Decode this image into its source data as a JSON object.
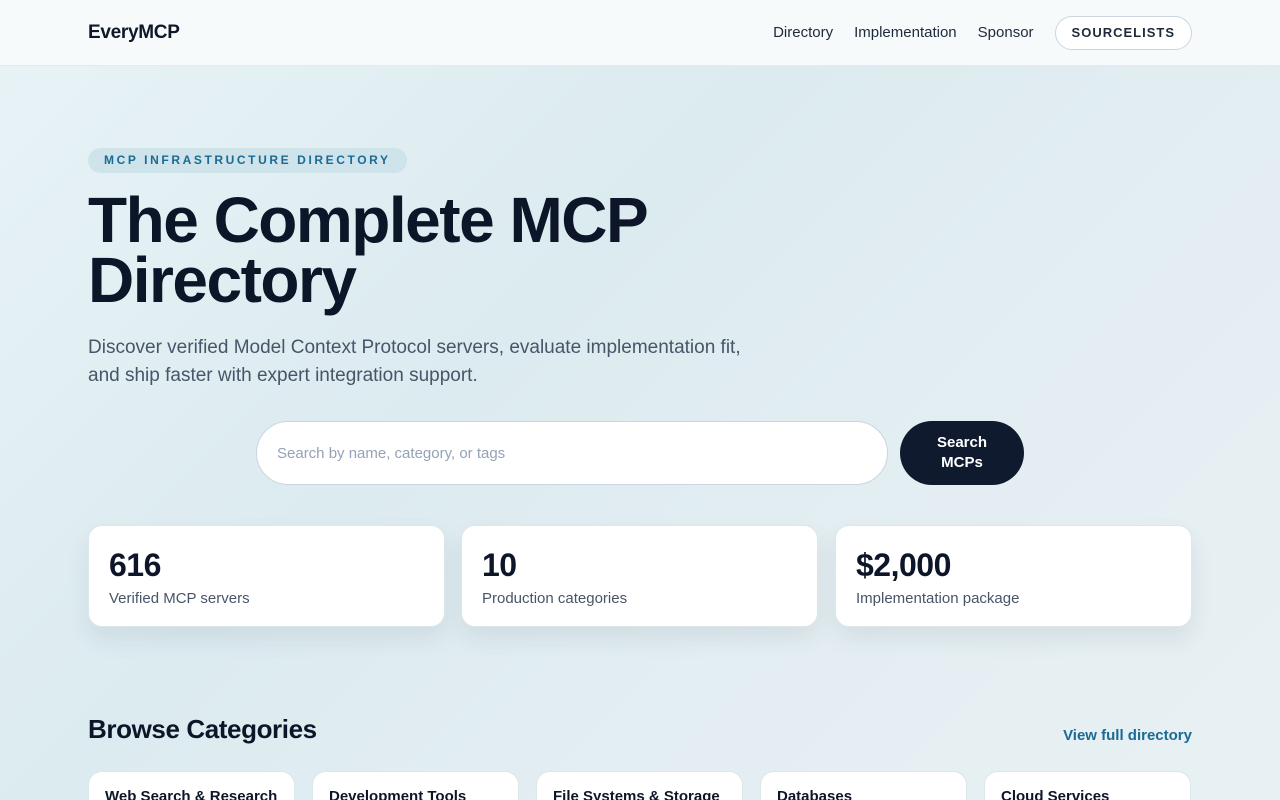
{
  "header": {
    "brand": "EveryMCP",
    "nav": [
      "Directory",
      "Implementation",
      "Sponsor"
    ],
    "cta": "SOURCELISTS"
  },
  "hero": {
    "eyebrow": "MCP INFRASTRUCTURE DIRECTORY",
    "title": "The Complete MCP Directory",
    "subtitle": "Discover verified Model Context Protocol servers, evaluate implementation fit, and ship faster with expert integration support."
  },
  "search": {
    "placeholder": "Search by name, category, or tags",
    "value": "",
    "button": "Search MCPs"
  },
  "stats": [
    {
      "value": "616",
      "label": "Verified MCP servers"
    },
    {
      "value": "10",
      "label": "Production categories"
    },
    {
      "value": "$2,000",
      "label": "Implementation package"
    }
  ],
  "categories": {
    "title": "Browse Categories",
    "view_all": "View full directory",
    "items": [
      "Web Search & Research",
      "Development Tools",
      "File Systems & Storage",
      "Databases",
      "Cloud Services"
    ]
  }
}
